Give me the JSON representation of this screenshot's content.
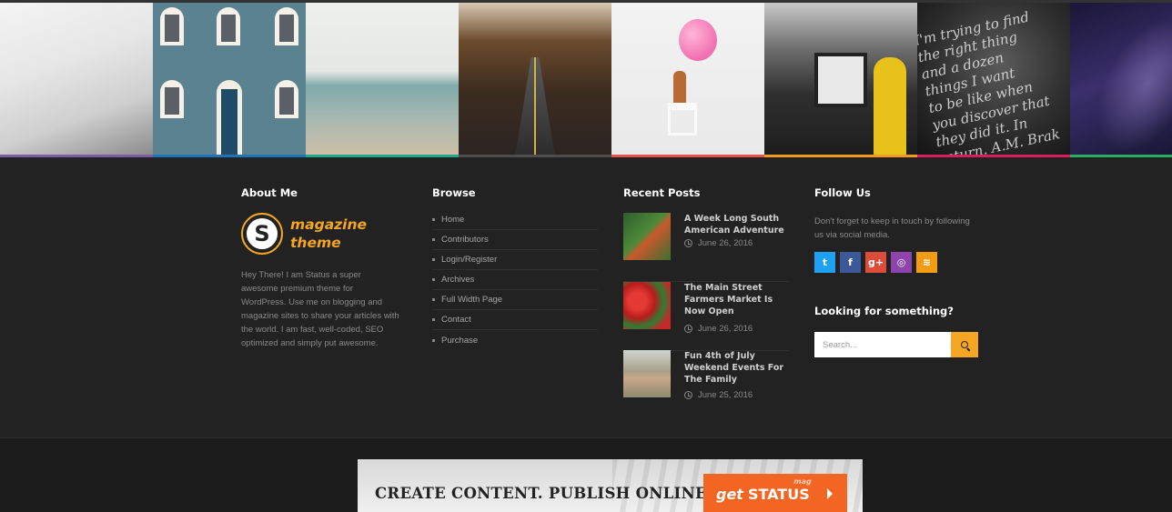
{
  "gallery": {
    "accent_colors": [
      "#7c5aa6",
      "#1f73b7",
      "#21a98f",
      "#4e4e4e",
      "#e5534b",
      "#f29a1f",
      "#d81e5b",
      "#27ae60"
    ],
    "script_text": "I'm trying to find\nthe right thing\nand a dozen\nthings I want\nto be like when\nyou discover that\nthey did it. In\nreturn. A.M. Brak"
  },
  "about": {
    "heading": "About Me",
    "logo_letter": "S",
    "logo_line1": "magazine",
    "logo_line2": "theme",
    "text": "Hey There! I am Status a super awesome premium theme for WordPress. Use me on blogging and magazine sites to share your articles with the world. I am fast, well-coded, SEO optimized and simply put awesome."
  },
  "browse": {
    "heading": "Browse",
    "items": [
      "Home",
      "Contributors",
      "Login/Register",
      "Archives",
      "Full Width Page",
      "Contact",
      "Purchase"
    ]
  },
  "recent": {
    "heading": "Recent Posts",
    "posts": [
      {
        "title": "A Week Long South American Adventure",
        "date": "June 26, 2016"
      },
      {
        "title": "The Main Street Farmers Market Is Now Open",
        "date": "June 26, 2016"
      },
      {
        "title": "Fun 4th of July Weekend Events For The Family",
        "date": "June 25, 2016"
      }
    ]
  },
  "follow": {
    "heading": "Follow Us",
    "text": "Don't forget to keep in touch by following us via social media.",
    "socials": [
      {
        "icon": "twitter-icon",
        "glyph": "t",
        "color": "#1da1f2"
      },
      {
        "icon": "facebook-icon",
        "glyph": "f",
        "color": "#3b5998"
      },
      {
        "icon": "google-plus-icon",
        "glyph": "g+",
        "color": "#dd4b39"
      },
      {
        "icon": "instagram-icon",
        "glyph": "◎",
        "color": "#8e44ad"
      },
      {
        "icon": "rss-icon",
        "glyph": "≋",
        "color": "#f39c12"
      }
    ],
    "search_heading": "Looking for something?",
    "search_placeholder": "Search..."
  },
  "banner": {
    "text": "CREATE CONTENT. PUBLISH ONLINE.",
    "cta_get": "get",
    "cta_status": "STATUS",
    "cta_mag": "mag"
  }
}
